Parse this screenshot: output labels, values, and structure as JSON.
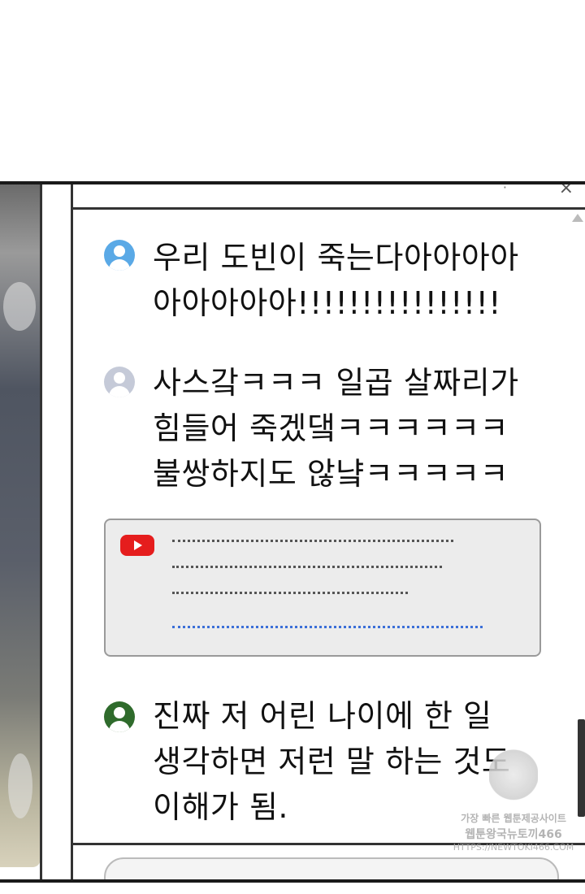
{
  "comments": [
    {
      "text": "우리 도빈이 죽는다아아아아\n아아아아아!!!!!!!!!!!!!!!!",
      "avatar_color": "#5aa9e6"
    },
    {
      "text": "사스갘ㅋㅋㅋ 일곱 살짜리가\n힘들어 죽겠댘ㅋㅋㅋㅋㅋㅋ\n불쌍하지도 않냨ㅋㅋㅋㅋㅋ",
      "avatar_color": "#c5cad8"
    },
    {
      "text": "진짜 저 어린 나이에 한 일\n생각하면 저런 말 하는 것도\n이해가 됨.",
      "avatar_color": "#2f6b2c"
    }
  ],
  "link_card": {
    "icon": "youtube-icon",
    "accent": "#e51d1d",
    "link_color": "#3b6fd8"
  },
  "watermark": {
    "line1": "가장 빠른 웹툰제공사이트",
    "line2": "웹툰왕국뉴토끼466",
    "line3": "HTTPS://NEWTOKI466.COM"
  }
}
